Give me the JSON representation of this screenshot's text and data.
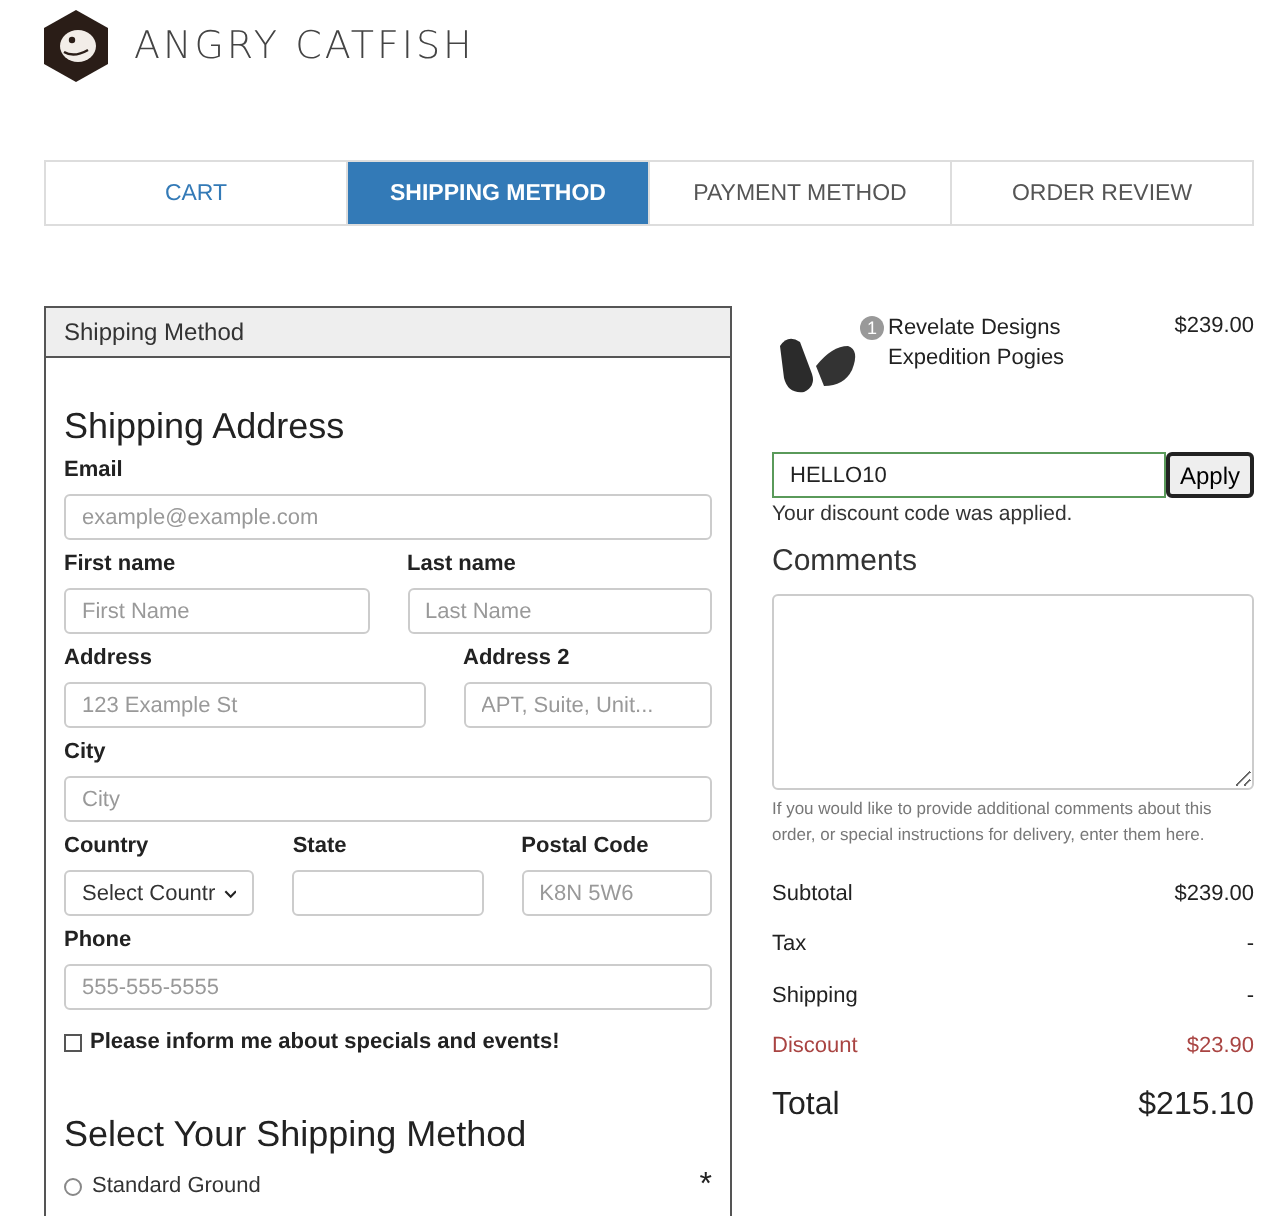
{
  "brand": {
    "name": "ANGRY CATFISH"
  },
  "steps": [
    {
      "label": "CART",
      "selected": false
    },
    {
      "label": "SHIPPING METHOD",
      "selected": true
    },
    {
      "label": "PAYMENT METHOD",
      "selected": false
    },
    {
      "label": "ORDER REVIEW",
      "selected": false
    }
  ],
  "panel": {
    "header": "Shipping Method",
    "heading": "Shipping Address",
    "rows": [
      [
        {
          "label": "Email",
          "kind": "text",
          "placeholder": "example@example.com"
        }
      ],
      [
        {
          "label": "First name",
          "kind": "text",
          "placeholder": "First Name"
        },
        {
          "label": "Last name",
          "kind": "text",
          "placeholder": "Last Name"
        }
      ],
      [
        {
          "label": "Address",
          "kind": "text",
          "placeholder": "123 Example St"
        },
        {
          "label": "Address 2",
          "kind": "text",
          "placeholder": "APT, Suite, Unit..."
        }
      ],
      [
        {
          "label": "City",
          "kind": "text",
          "placeholder": "City"
        }
      ],
      [
        {
          "label": "Country",
          "kind": "select",
          "value": "Select Countr"
        },
        {
          "label": "State",
          "kind": "text"
        },
        {
          "label": "Postal Code",
          "kind": "text",
          "placeholder": "K8N 5W6"
        }
      ],
      [
        {
          "label": "Phone",
          "kind": "text",
          "placeholder": "555-555-5555"
        }
      ]
    ],
    "newsletter": {
      "label": "Please inform me about specials and events!",
      "checked": false
    },
    "method_heading": "Select Your Shipping Method",
    "methods": [
      {
        "label": "Standard Ground",
        "selected": false
      }
    ],
    "required_mark": "*"
  },
  "cart": {
    "items": [
      {
        "quantity": "1",
        "name": "Revelate Designs Expedition Pogies",
        "price": "$239.00"
      }
    ]
  },
  "discount": {
    "value": "HELLO10",
    "button": "Apply",
    "message": "Your discount code was applied."
  },
  "comments": {
    "heading": "Comments",
    "hint": "If you would like to provide additional comments about this order, or special instructions for delivery, enter them here."
  },
  "totals": [
    {
      "label": "Subtotal",
      "value": "$239.00",
      "kind": "normal"
    },
    {
      "label": "Tax",
      "value": "-",
      "kind": "normal"
    },
    {
      "label": "Shipping",
      "value": "-",
      "kind": "normal"
    },
    {
      "label": "Discount",
      "value": "$23.90",
      "kind": "discount"
    },
    {
      "label": "Total",
      "value": "$215.10",
      "kind": "total"
    }
  ]
}
